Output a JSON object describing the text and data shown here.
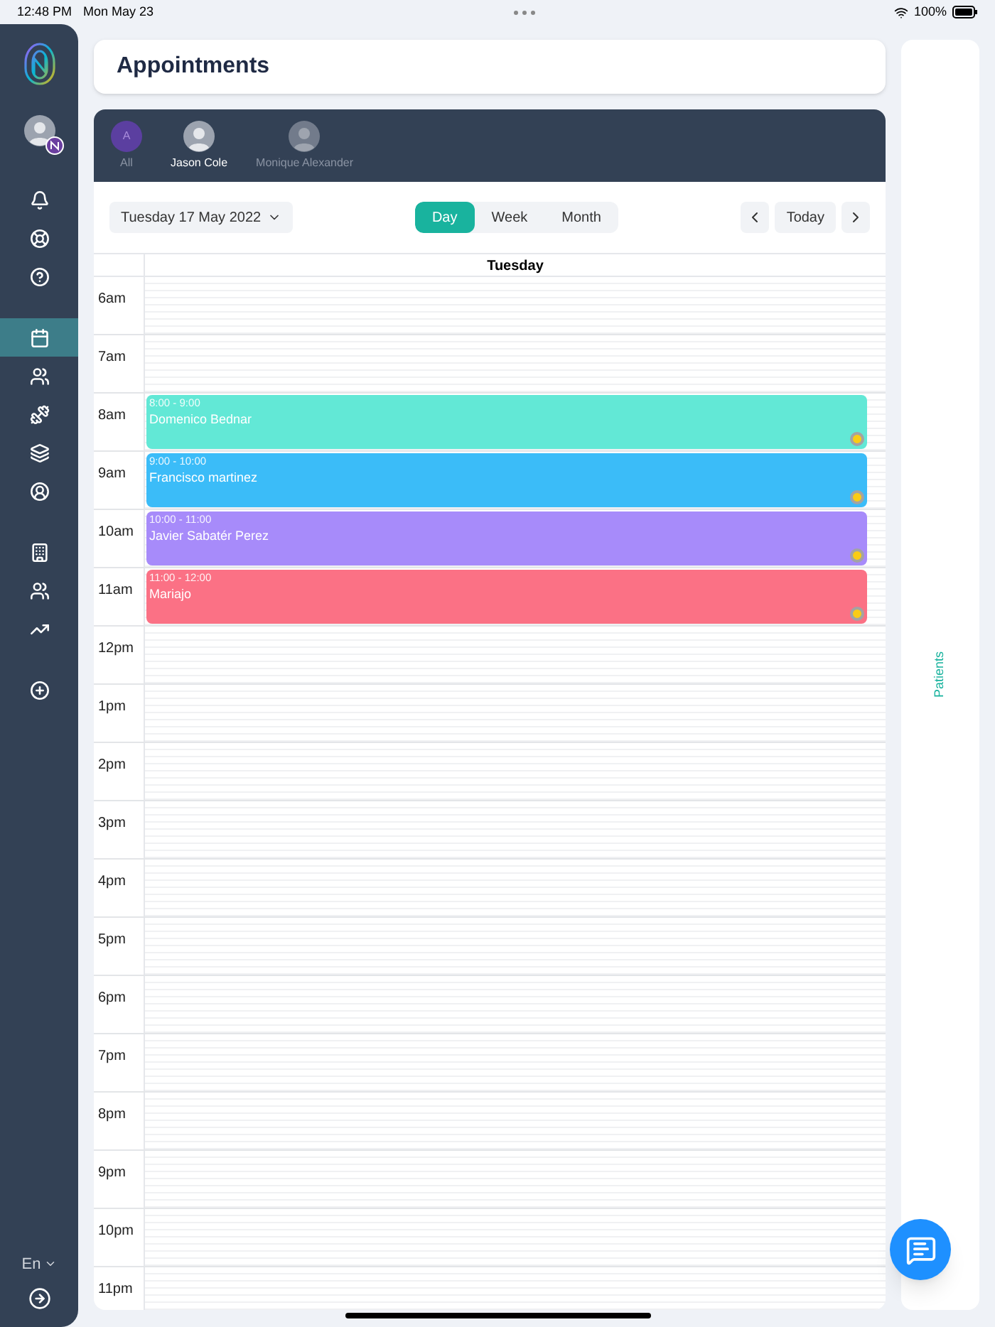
{
  "status_bar": {
    "time": "12:48 PM",
    "date": "Mon May 23",
    "battery": "100%"
  },
  "sidebar": {
    "items": [
      {
        "kind": "bell",
        "selected": false
      },
      {
        "kind": "lifebuoy",
        "selected": false
      },
      {
        "kind": "help",
        "selected": false
      },
      {
        "kind": "calendar",
        "selected": true
      },
      {
        "kind": "users",
        "selected": false
      },
      {
        "kind": "dumbbell",
        "selected": false
      },
      {
        "kind": "layers",
        "selected": false
      },
      {
        "kind": "user",
        "selected": false
      },
      {
        "kind": "building",
        "selected": false
      },
      {
        "kind": "group",
        "selected": false
      },
      {
        "kind": "trend",
        "selected": false
      },
      {
        "kind": "add",
        "selected": false
      }
    ],
    "language": "En"
  },
  "page": {
    "title": "Appointments"
  },
  "staff": [
    {
      "kind": "letter",
      "initial": "A",
      "name": "All",
      "selected": false
    },
    {
      "kind": "photo",
      "name": "Jason Cole",
      "selected": true
    },
    {
      "kind": "photo",
      "name": "Monique Alexander",
      "selected": false
    }
  ],
  "toolbar": {
    "date": "Tuesday 17 May 2022",
    "views": [
      {
        "label": "Day",
        "selected": true
      },
      {
        "label": "Week",
        "selected": false
      },
      {
        "label": "Month",
        "selected": false
      }
    ],
    "today": "Today"
  },
  "calendar": {
    "day": "Tuesday",
    "hours": [
      {
        "label": "6am"
      },
      {
        "label": "7am"
      },
      {
        "label": "8am",
        "appointments": [
          {
            "time": "8:00 - 9:00",
            "name": "Domenico Bednar",
            "color": "#62e8d6"
          }
        ]
      },
      {
        "label": "9am",
        "appointments": [
          {
            "time": "9:00 - 10:00",
            "name": "Francisco martinez",
            "color": "#3bbcf8"
          }
        ]
      },
      {
        "label": "10am",
        "appointments": [
          {
            "time": "10:00 - 11:00",
            "name": "Javier Sabatér Perez",
            "color": "#a78bfa"
          }
        ]
      },
      {
        "label": "11am",
        "appointments": [
          {
            "time": "11:00 - 12:00",
            "name": "Mariajo",
            "color": "#fb7185"
          }
        ]
      },
      {
        "label": "12pm"
      },
      {
        "label": "1pm"
      },
      {
        "label": "2pm"
      },
      {
        "label": "3pm"
      },
      {
        "label": "4pm"
      },
      {
        "label": "5pm"
      },
      {
        "label": "6pm"
      },
      {
        "label": "7pm"
      },
      {
        "label": "8pm"
      },
      {
        "label": "9pm"
      },
      {
        "label": "10pm"
      },
      {
        "label": "11pm"
      }
    ]
  },
  "side_panel": {
    "label": "Patients"
  }
}
